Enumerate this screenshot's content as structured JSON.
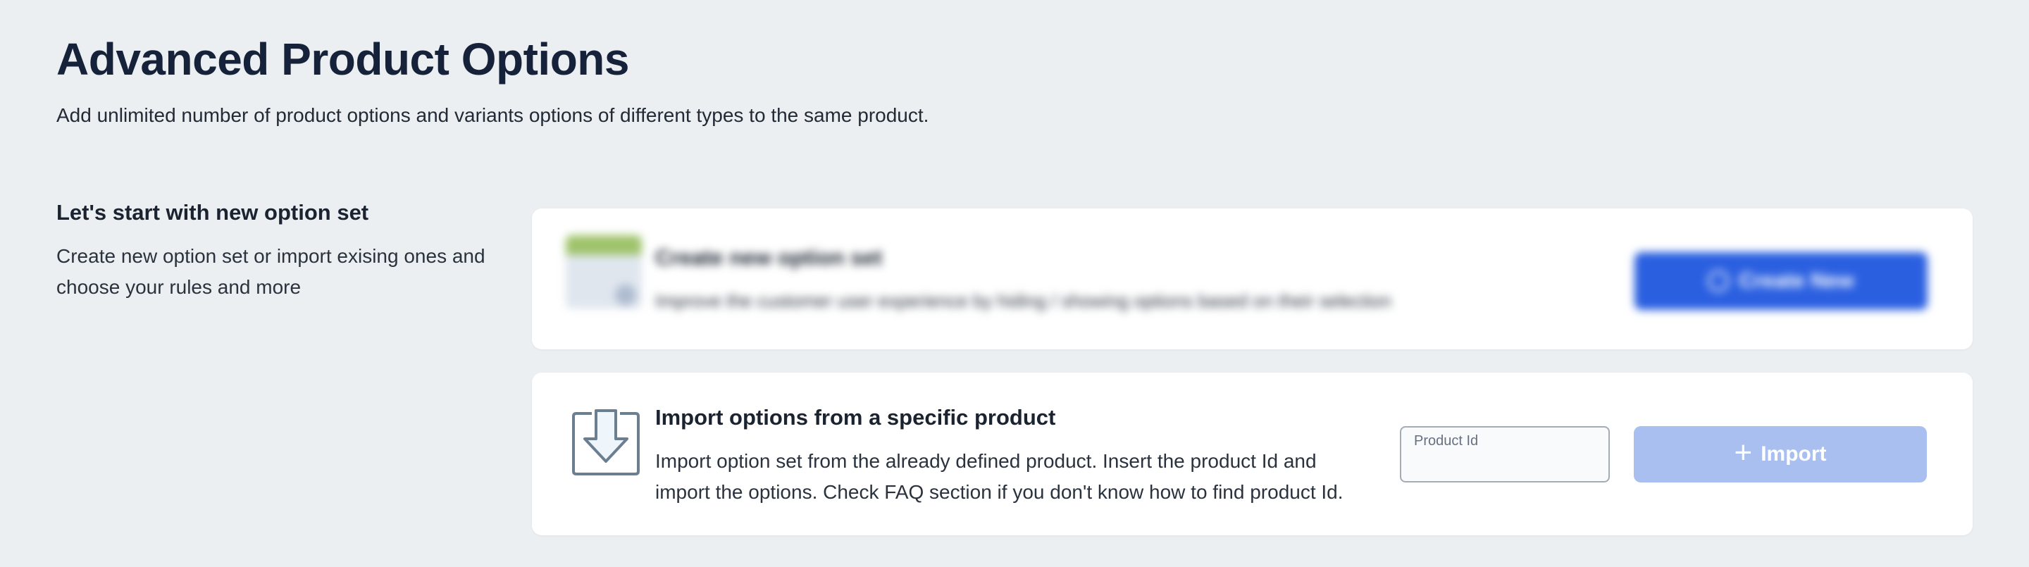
{
  "header": {
    "title": "Advanced Product Options",
    "subtitle": "Add unlimited number of product options and variants options of different types to the same product."
  },
  "intro": {
    "title": "Let's start with new option set",
    "description": "Create new option set or import exising ones and choose your rules and more"
  },
  "create_card": {
    "title": "Create new option set",
    "description": "Improve the customer user experience by hiding / showing options based on their selection",
    "button_label": "Create New",
    "icon": "option-set-icon",
    "blurred": true
  },
  "import_card": {
    "title": "Import options from a specific product",
    "description": "Import option set from the already defined product. Insert the product Id and import the options. Check FAQ section if you don't know how to find product Id.",
    "field_label": "Product Id",
    "field_value": "",
    "button_label": "Import",
    "icon": "download-icon"
  },
  "colors": {
    "background": "#eceff2",
    "primary": "#2a5fe0",
    "primary_disabled": "#a9bff0",
    "icon_stroke": "#6b7f91"
  }
}
